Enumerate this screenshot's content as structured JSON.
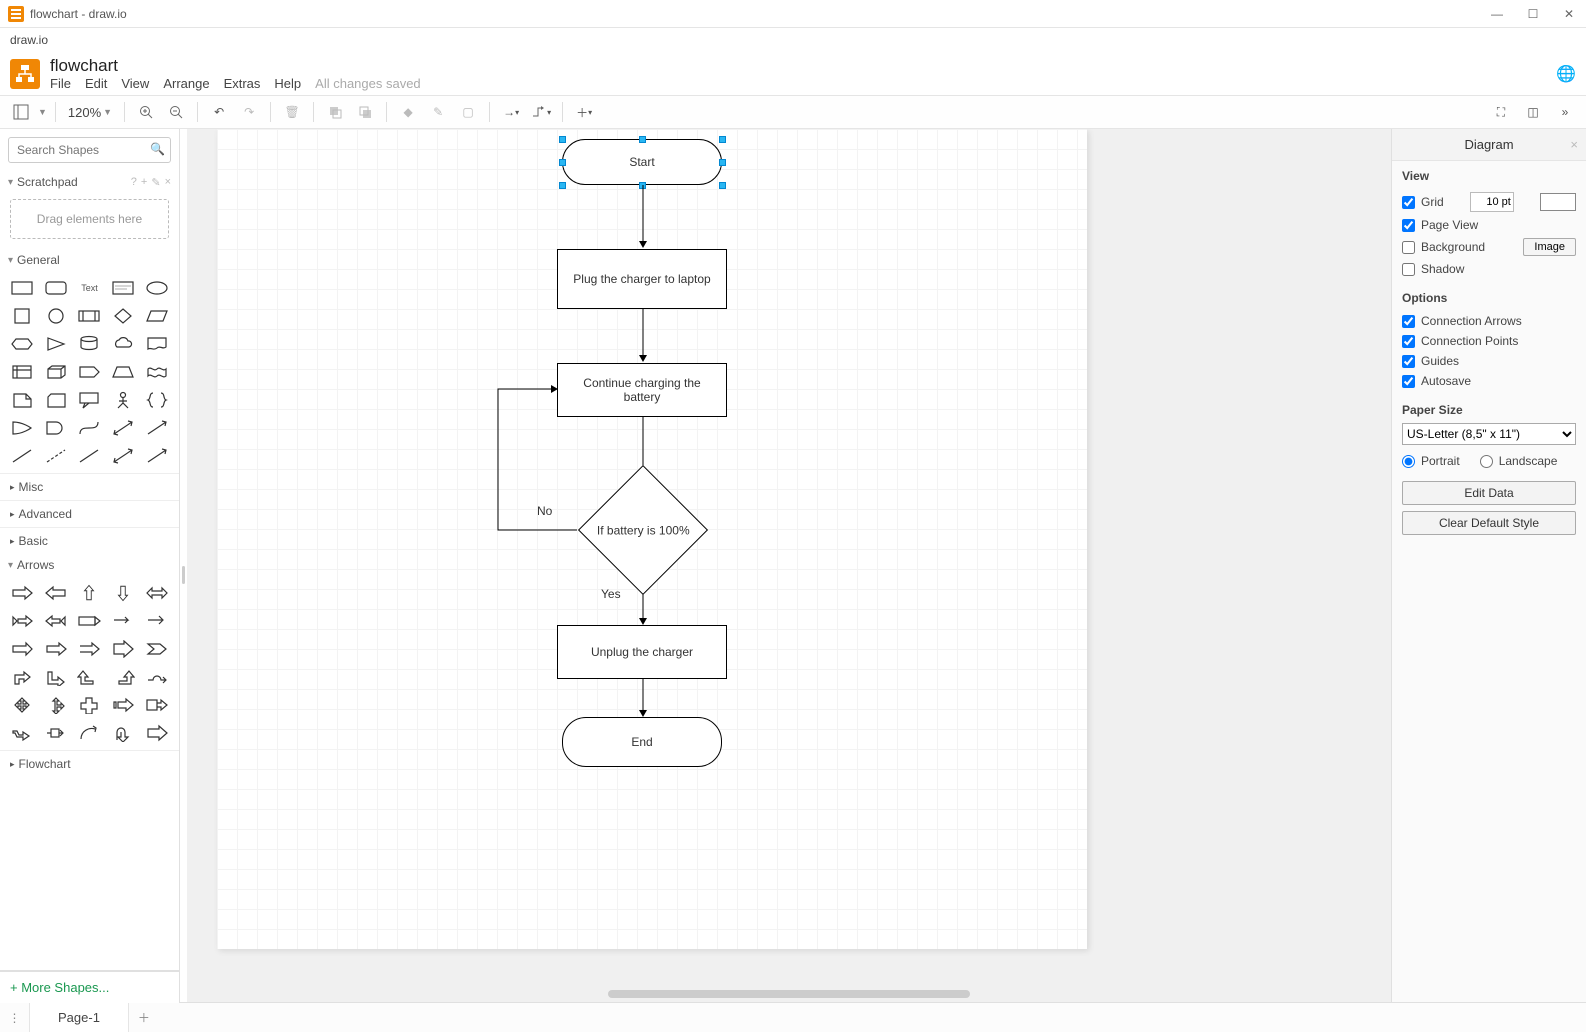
{
  "window": {
    "title": "flowchart - draw.io"
  },
  "subtitle": "draw.io",
  "document": {
    "title": "flowchart"
  },
  "menu": {
    "items": [
      "File",
      "Edit",
      "View",
      "Arrange",
      "Extras",
      "Help"
    ],
    "status": "All changes saved"
  },
  "toolbar": {
    "zoom": "120%"
  },
  "sidebar": {
    "search_placeholder": "Search Shapes",
    "scratchpad_label": "Scratchpad",
    "scratchpad_hint": "Drag elements here",
    "sections": {
      "general": "General",
      "misc": "Misc",
      "advanced": "Advanced",
      "basic": "Basic",
      "arrows": "Arrows",
      "flowchart": "Flowchart"
    },
    "more_shapes": "+ More Shapes..."
  },
  "canvas": {
    "nodes": {
      "start": "Start",
      "plug": "Plug the charger to laptop",
      "continue": "Continue charging the battery",
      "decision": "If battery is 100%",
      "unplug": "Unplug the charger",
      "end": "End"
    },
    "edge_labels": {
      "no": "No",
      "yes": "Yes"
    }
  },
  "right": {
    "panel_title": "Diagram",
    "view_label": "View",
    "grid": "Grid",
    "grid_value": "10 pt",
    "page_view": "Page View",
    "background": "Background",
    "image_btn": "Image",
    "shadow": "Shadow",
    "options_label": "Options",
    "conn_arrows": "Connection Arrows",
    "conn_points": "Connection Points",
    "guides": "Guides",
    "autosave": "Autosave",
    "paper_size_label": "Paper Size",
    "paper_size_value": "US-Letter (8,5\" x 11\")",
    "portrait": "Portrait",
    "landscape": "Landscape",
    "edit_data": "Edit Data",
    "clear_style": "Clear Default Style"
  },
  "footer": {
    "page": "Page-1"
  },
  "chart_data": {
    "type": "flowchart",
    "nodes": [
      {
        "id": "start",
        "kind": "terminator",
        "label": "Start"
      },
      {
        "id": "plug",
        "kind": "process",
        "label": "Plug the charger to laptop"
      },
      {
        "id": "continue",
        "kind": "process",
        "label": "Continue charging the battery"
      },
      {
        "id": "decision",
        "kind": "decision",
        "label": "If battery is 100%"
      },
      {
        "id": "unplug",
        "kind": "process",
        "label": "Unplug the charger"
      },
      {
        "id": "end",
        "kind": "terminator",
        "label": "End"
      }
    ],
    "edges": [
      {
        "from": "start",
        "to": "plug"
      },
      {
        "from": "plug",
        "to": "continue"
      },
      {
        "from": "continue",
        "to": "decision"
      },
      {
        "from": "decision",
        "to": "unplug",
        "label": "Yes"
      },
      {
        "from": "decision",
        "to": "continue",
        "label": "No"
      },
      {
        "from": "unplug",
        "to": "end"
      }
    ]
  }
}
